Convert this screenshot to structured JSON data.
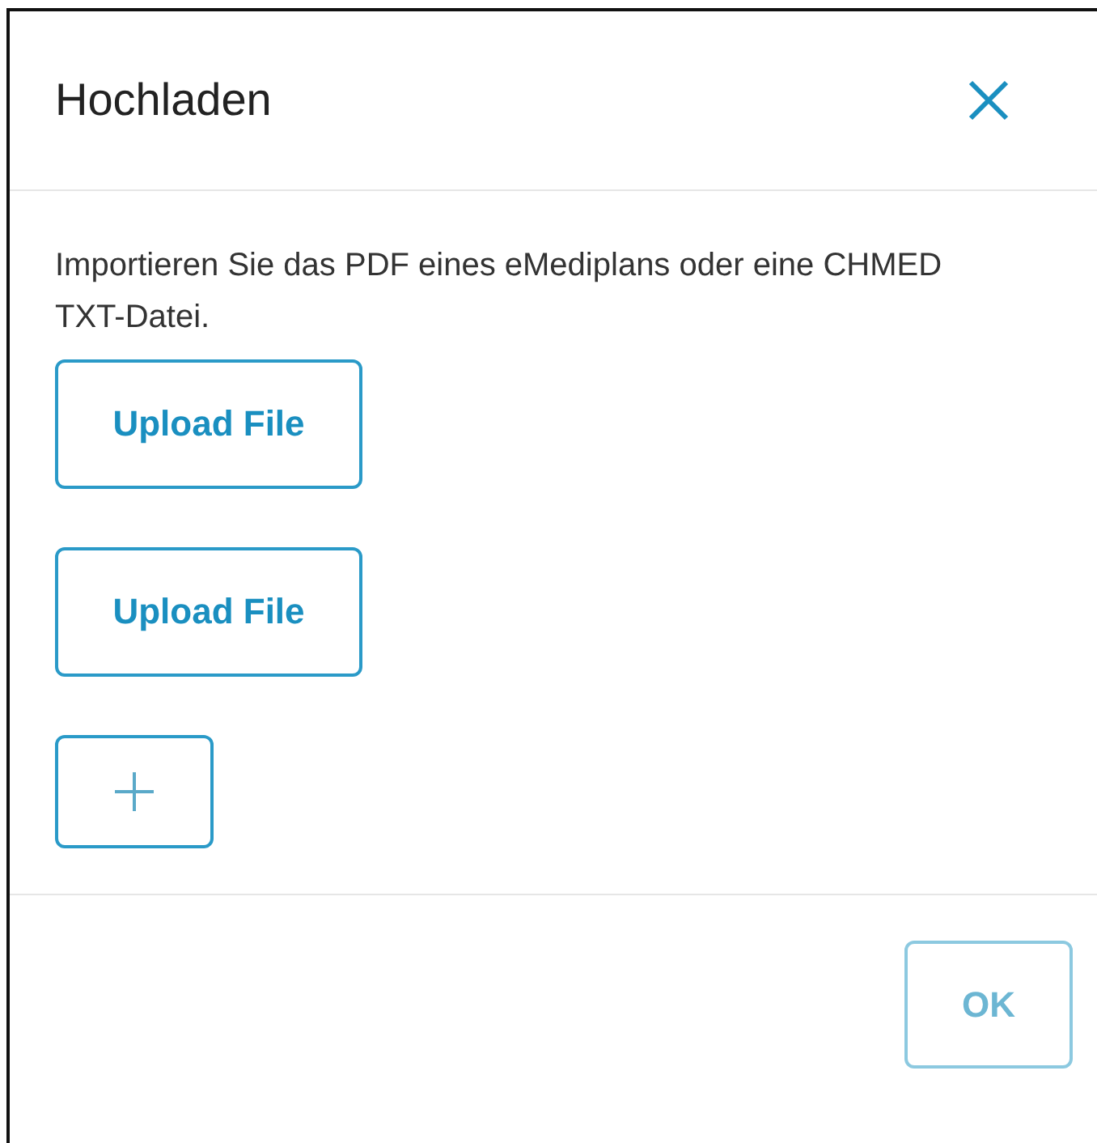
{
  "dialog": {
    "title": "Hochladen",
    "description": "Importieren Sie das PDF eines eMediplans oder eine CHMED TXT-Datei.",
    "uploads": [
      {
        "label": "Upload File"
      },
      {
        "label": "Upload File"
      }
    ],
    "footer_button": {
      "label": "OK",
      "disabled": true
    }
  }
}
